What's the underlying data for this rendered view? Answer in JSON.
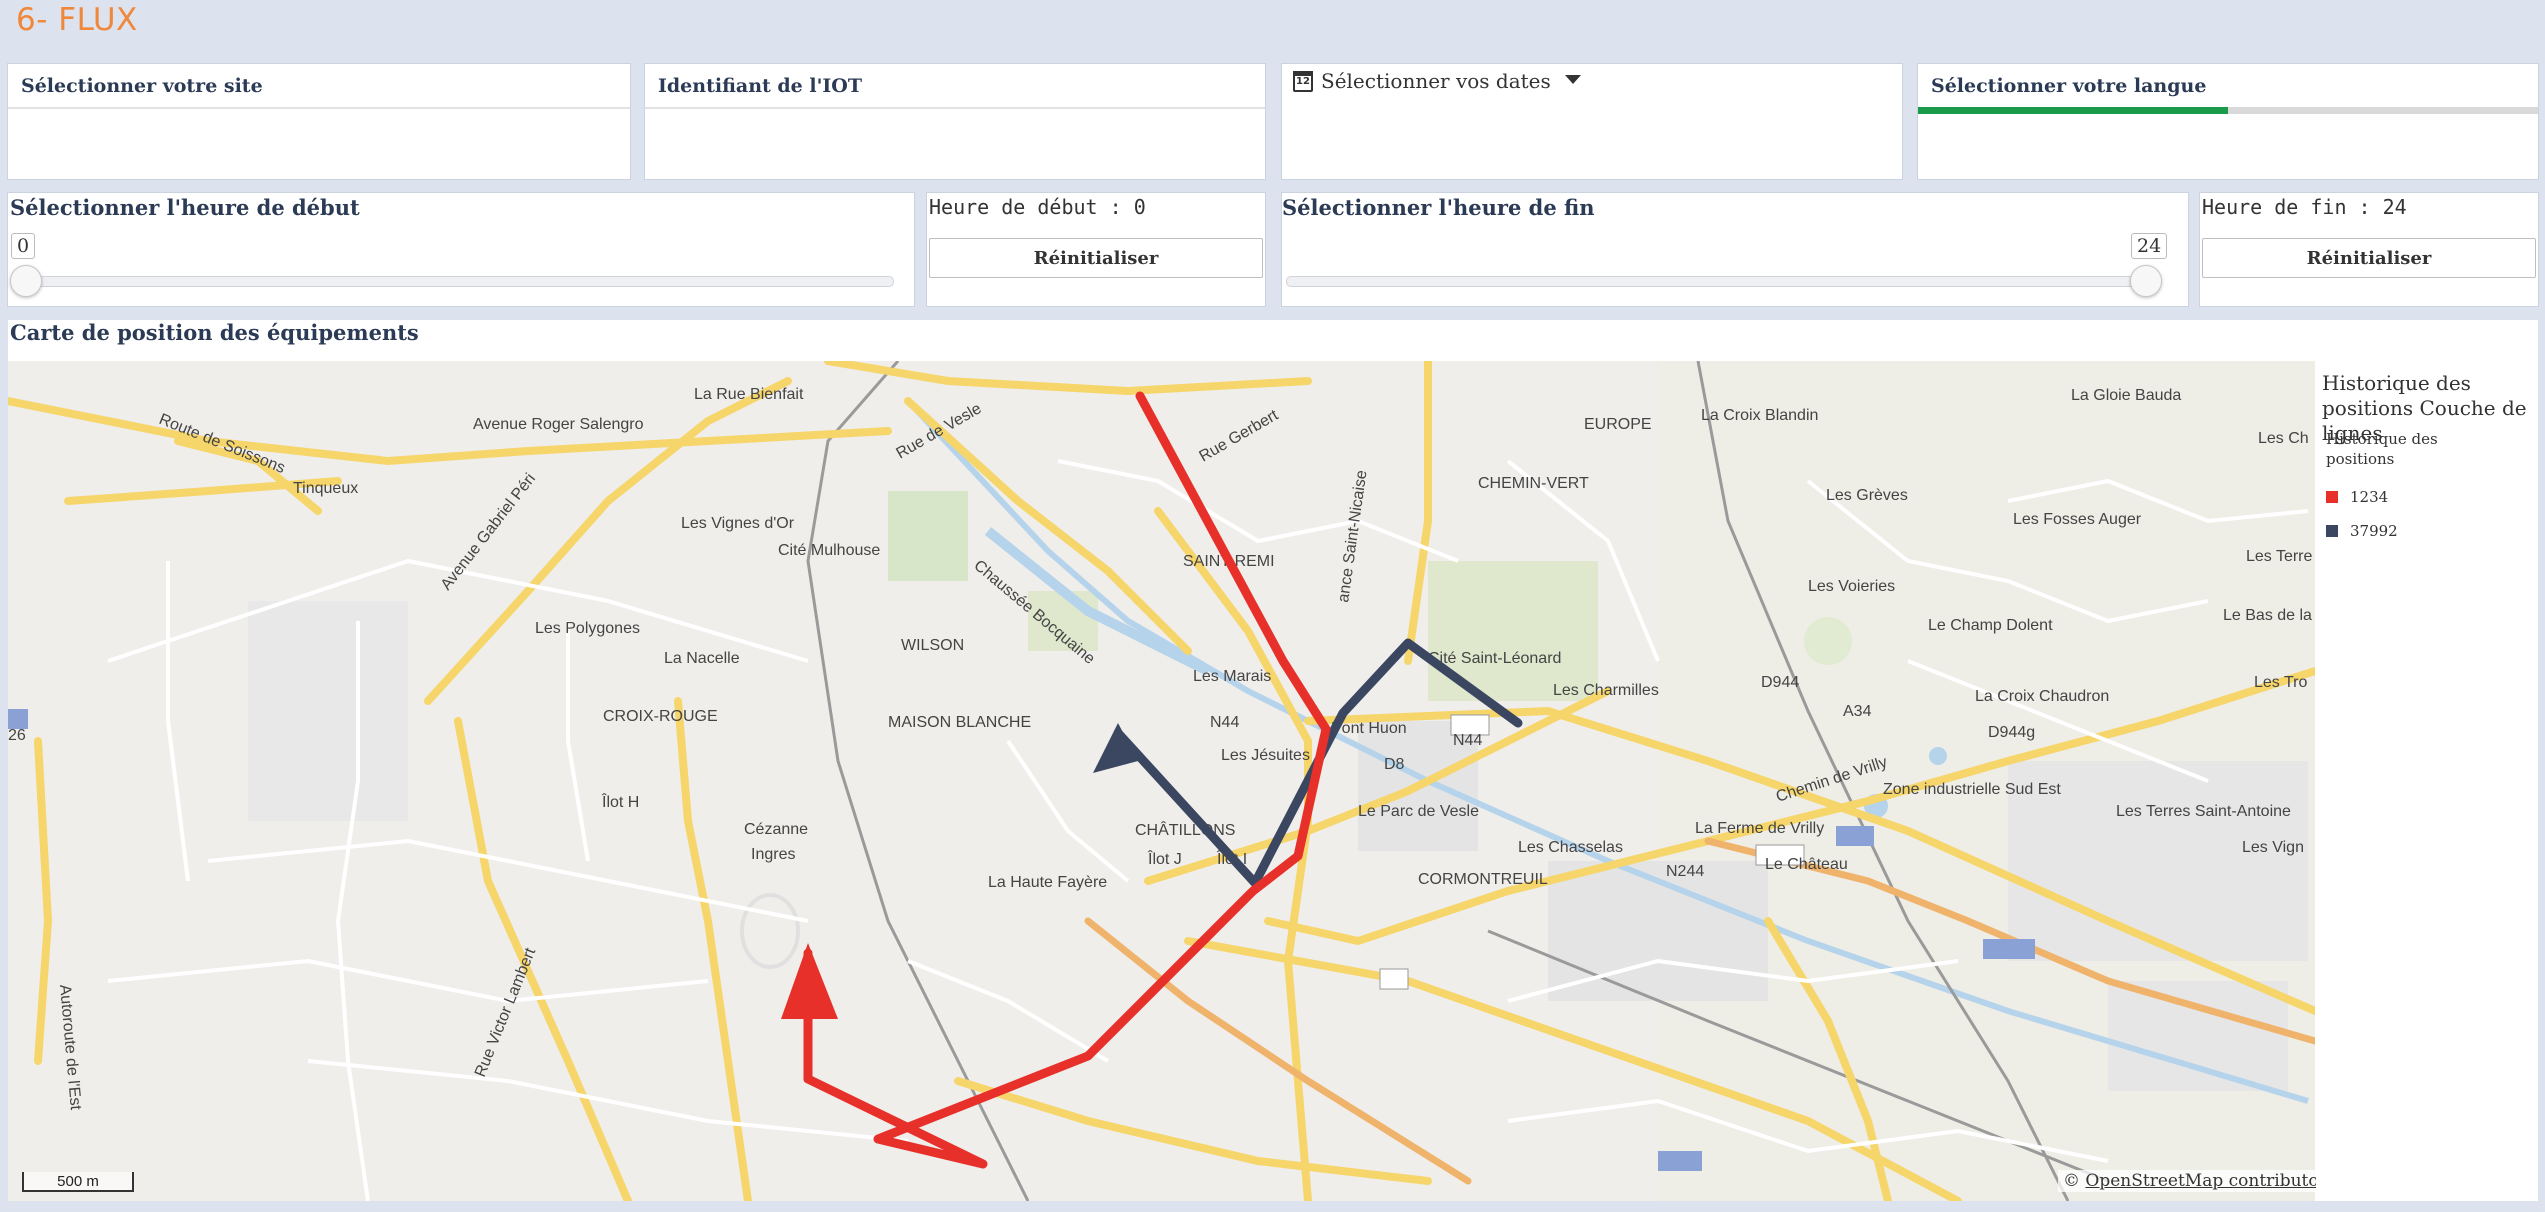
{
  "page": {
    "title": "6- FLUX"
  },
  "filters": {
    "site": {
      "label": "Sélectionner votre site"
    },
    "iot": {
      "label": "Identifiant de l'IOT"
    },
    "dates": {
      "label": "Sélectionner vos dates",
      "icon": "calendar-icon"
    },
    "language": {
      "label": "Sélectionner votre langue",
      "progress_fraction": 0.5,
      "progress_color": "#1a9a4b"
    }
  },
  "start_hour": {
    "title": "Sélectionner l'heure de début",
    "value": "0",
    "min": 0,
    "max": 24,
    "display": "Heure de début : 0",
    "reset_label": "Réinitialiser"
  },
  "end_hour": {
    "title": "Sélectionner l'heure de fin",
    "value": "24",
    "min": 0,
    "max": 24,
    "display": "Heure de fin : 24",
    "reset_label": "Réinitialiser"
  },
  "map": {
    "title": "Carte de position des équipements",
    "scale_label": "500 m",
    "attribution_prefix": "© ",
    "attribution_link": "OpenStreetMap contributors",
    "places": [
      "La Rue Bienfait",
      "Avenue Roger Salengro",
      "Route de Soissons",
      "Tinqueux",
      "Rue de Vesle",
      "Rue Gerbert",
      "EUROPE",
      "La Croix Blandin",
      "La Gloie Bauda",
      "Les Ch",
      "CHEMIN-VERT",
      "Les Grèves",
      "Les Fosses Auger",
      "Les Terre",
      "Les Voieries",
      "Avenue Gabriel Péri",
      "Les Vignes d'Or",
      "Cité Mulhouse",
      "Chaussée Bocquaine",
      "SAINT-REMI",
      "ance Saint-Nicaise",
      "N44",
      "Le Champ Dolent",
      "Le Bas de la",
      "Les Polygones",
      "WILSON",
      "La Nacelle",
      "Cité Saint-Léonard",
      "D944",
      "A34",
      "Les Charmilles",
      "Les Marais",
      "Les Tro",
      "La Croix Chaudron",
      "Autoroute de l'Est",
      "CROIX-ROUGE",
      "MAISON BLANCHE",
      "N44",
      "Pont Huon",
      "D944g",
      "Les Jésuites",
      "D8",
      "Chemin de Vrilly",
      "Zone industrielle Sud Est",
      "Rue Victor Lambert",
      "Îlot H",
      "Cézanne",
      "Le Parc de Vesle",
      "Les Terres Saint-Antoine",
      "CHÂTILLONS",
      "Ingres",
      "Îlot J",
      "Îlot I",
      "Les Chasselas",
      "La Ferme de Vrilly",
      "Les Vign",
      "La Haute Fayère",
      "CORMONTREUIL",
      "N244",
      "Le Château",
      "26"
    ]
  },
  "legend": {
    "title": "Historique des positions Couche de lignes",
    "subtitle": "Historique des positions",
    "items": [
      {
        "label": "1234",
        "color": "#e8302a"
      },
      {
        "label": "37992",
        "color": "#3b4660"
      }
    ]
  }
}
